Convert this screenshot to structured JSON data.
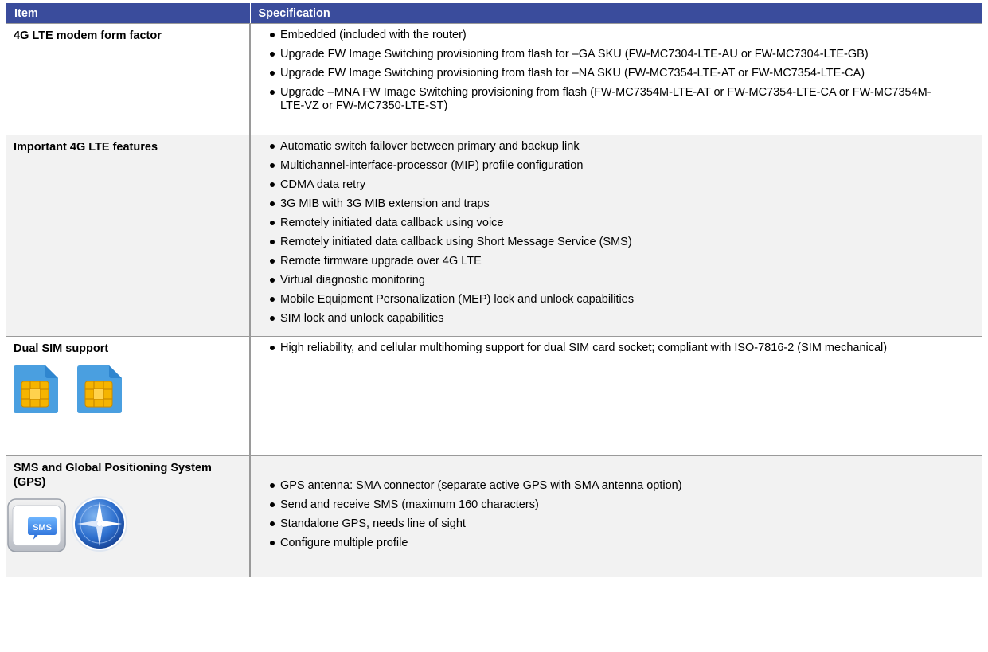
{
  "table": {
    "headers": {
      "item": "Item",
      "spec": "Specification"
    },
    "rows": [
      {
        "item": "4G LTE modem form factor",
        "specs": [
          "Embedded (included with the router)",
          "Upgrade FW Image Switching provisioning from flash for –GA SKU (FW-MC7304-LTE-AU or FW-MC7304-LTE-GB)",
          "Upgrade FW Image Switching provisioning from flash for –NA SKU (FW-MC7354-LTE-AT or FW-MC7354-LTE-CA)",
          "Upgrade –MNA FW Image Switching provisioning from flash (FW-MC7354M-LTE-AT or FW-MC7354-LTE-CA or FW-MC7354M-LTE-VZ or FW-MC7350-LTE-ST)"
        ]
      },
      {
        "item": "Important 4G LTE features",
        "specs": [
          "Automatic switch failover between primary and backup link",
          "Multichannel-interface-processor (MIP) profile configuration",
          "CDMA data retry",
          "3G MIB with 3G MIB extension and traps",
          "Remotely initiated data callback using voice",
          "Remotely initiated data callback using Short Message Service (SMS)",
          "Remote firmware upgrade over 4G LTE",
          "Virtual diagnostic monitoring",
          "Mobile Equipment Personalization (MEP) lock and unlock capabilities",
          "SIM lock and unlock capabilities"
        ]
      },
      {
        "item": "Dual SIM support",
        "specs": [
          "High reliability, and cellular multihoming support for dual SIM card socket; compliant with ISO-7816-2 (SIM mechanical)"
        ],
        "icons": [
          "sim-card-icon",
          "sim-card-icon"
        ]
      },
      {
        "item": "SMS and Global Positioning System (GPS)",
        "specs": [
          "GPS antenna: SMA connector (separate active GPS with SMA antenna option)",
          "Send and receive SMS (maximum 160 characters)",
          "Standalone GPS, needs line of sight",
          "Configure multiple profile"
        ],
        "icons": [
          "sms-icon",
          "compass-icon"
        ],
        "sms_icon_text": "SMS"
      }
    ]
  },
  "colors": {
    "header_background": "#3a4c9c",
    "header_text": "#ffffff",
    "shaded_row": "#f2f2f2",
    "sim_card_blue": "#4a9fe0",
    "sim_chip_gold": "#f5b400"
  }
}
